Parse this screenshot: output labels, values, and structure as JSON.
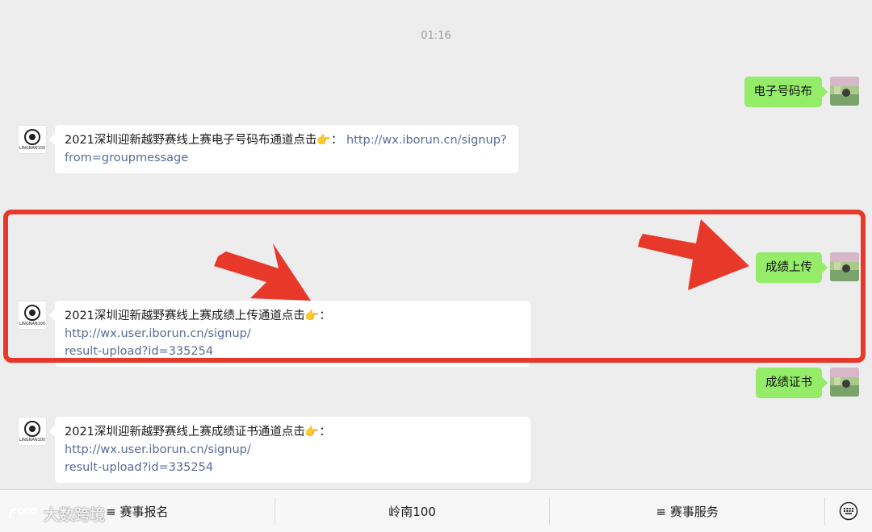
{
  "chat": {
    "timestamp": "01:16",
    "messages": [
      {
        "text": "电子号码布"
      },
      {
        "text_prefix": "2021深圳迎新越野赛线上赛电子号码布通道点击",
        "hand": "👉",
        "colon": "：",
        "link_line1": "http://wx.iborun.cn/signup?",
        "link_line2": "from=groupmessage"
      },
      {
        "text": "成绩上传"
      },
      {
        "text_prefix": "2021深圳迎新越野赛线上赛成绩上传通道点击",
        "hand": "👉",
        "colon": "：",
        "link_line1": "http://wx.user.iborun.cn/signup/",
        "link_line2": "result-upload?id=335254"
      },
      {
        "text": "成绩证书"
      },
      {
        "text_prefix": "2021深圳迎新越野赛线上赛成绩证书通道点击",
        "hand": "👉",
        "colon": "：",
        "link_line1": "http://wx.user.iborun.cn/signup/",
        "link_line2": "result-upload?id=335254"
      }
    ],
    "logo_text": "LINGNAN100"
  },
  "menu": {
    "items": [
      {
        "label": "≡ 赛事报名"
      },
      {
        "label": "岭南100"
      },
      {
        "label": "≡ 赛事服务"
      }
    ]
  },
  "watermark": {
    "text": "大数跨境"
  },
  "colors": {
    "sent_bubble": "#95ec69",
    "received_bubble": "#ffffff",
    "link": "#576b95",
    "highlight": "#e8382a",
    "background": "#ededed"
  }
}
